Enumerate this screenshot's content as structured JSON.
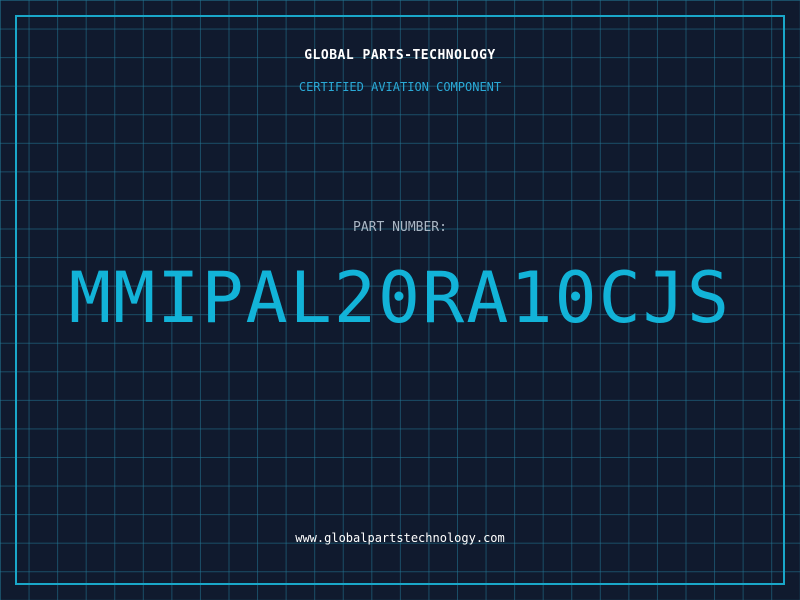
{
  "header": {
    "company_name": "GLOBAL PARTS-TECHNOLOGY",
    "tagline": "CERTIFIED AVIATION COMPONENT"
  },
  "part": {
    "label": "PART NUMBER:",
    "number": "MMIPAL20RA10CJS"
  },
  "footer": {
    "website": "www.globalpartstechnology.com"
  },
  "colors": {
    "background": "#101a2e",
    "grid": "#23788f",
    "accent": "#12b3d8",
    "frame": "#1aa7c9"
  }
}
